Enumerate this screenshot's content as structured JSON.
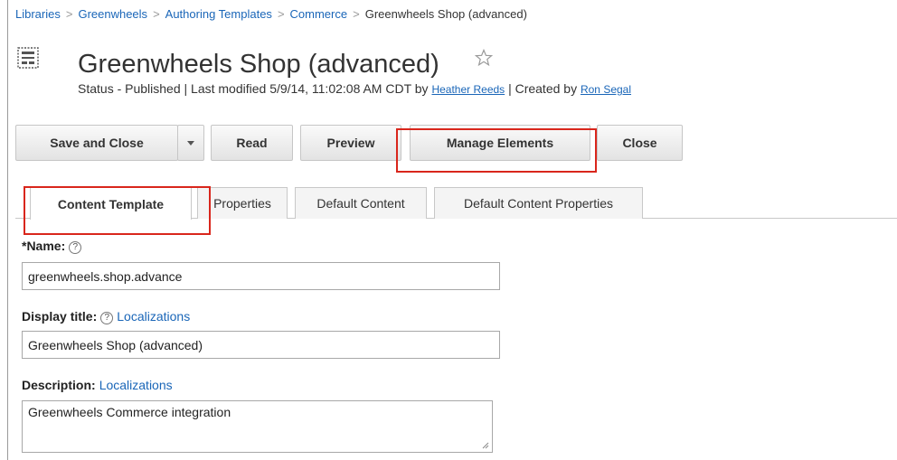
{
  "breadcrumb": [
    {
      "label": "Libraries",
      "link": true
    },
    {
      "label": "Greenwheels",
      "link": true
    },
    {
      "label": "Authoring Templates",
      "link": true
    },
    {
      "label": "Commerce",
      "link": true
    },
    {
      "label": "Greenwheels Shop (advanced)",
      "link": false
    }
  ],
  "breadcrumb_separator": ">",
  "header": {
    "icon": "template-icon",
    "title": "Greenwheels Shop (advanced)",
    "favorite_icon": "star-outline-icon",
    "status_prefix": "Status - Published | Last modified 5/9/14, 11:02:08 AM CDT by",
    "modified_by": "Heather Reeds",
    "created_prefix": "| Created by",
    "created_by": "Ron Segal"
  },
  "toolbar": {
    "save_close": "Save and Close",
    "read": "Read",
    "preview": "Preview",
    "manage_elements": "Manage Elements",
    "close": "Close"
  },
  "tabs": [
    {
      "label": "Content Template",
      "active": true
    },
    {
      "label": "Properties",
      "active": false
    },
    {
      "label": "Default Content",
      "active": false
    },
    {
      "label": "Default Content Properties",
      "active": false
    }
  ],
  "form": {
    "name_label": "*Name:",
    "name_value": "greenwheels.shop.advance",
    "display_title_label": "Display title:",
    "display_title_value": "Greenwheels Shop (advanced)",
    "description_label": "Description:",
    "description_value": "Greenwheels Commerce integration",
    "localizations_link": "Localizations",
    "help_glyph": "?"
  },
  "colors": {
    "link": "#1a66b8",
    "highlight": "#d9261c"
  }
}
